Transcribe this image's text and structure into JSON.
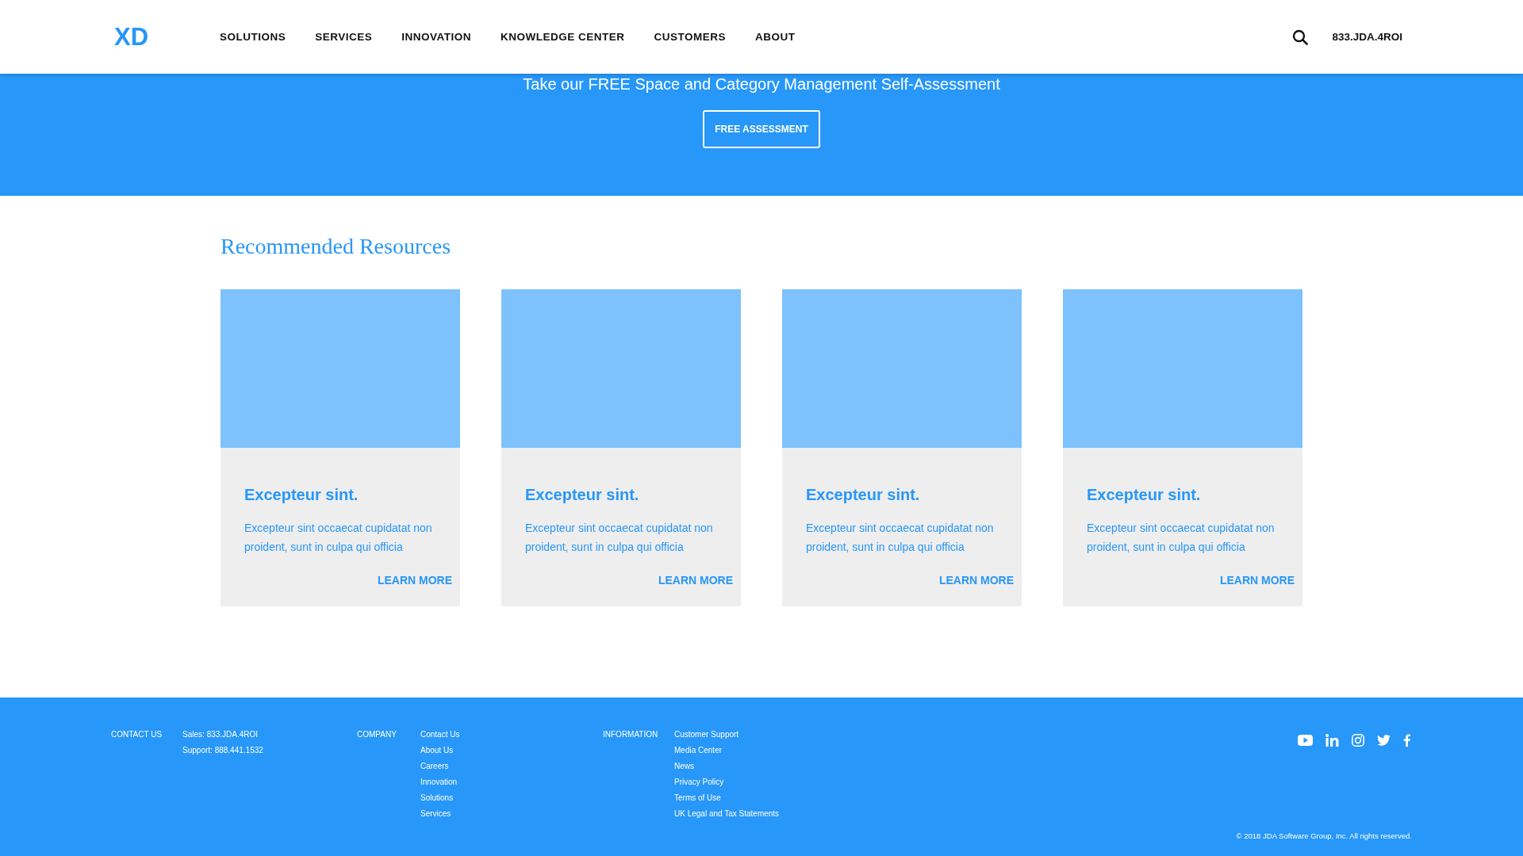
{
  "header": {
    "logo": "XD",
    "nav": [
      "SOLUTIONS",
      "SERVICES",
      "INNOVATION",
      "KNOWLEDGE CENTER",
      "CUSTOMERS",
      "ABOUT"
    ],
    "phone": "833.JDA.4ROI"
  },
  "banner": {
    "text": "Take our FREE Space and Category Management Self-Assessment",
    "button": "FREE ASSESSMENT"
  },
  "resources": {
    "title": "Recommended Resources",
    "cards": [
      {
        "title": "Excepteur sint.",
        "text": "Excepteur sint occaecat cupidatat non proident, sunt in culpa qui officia",
        "link": "LEARN MORE"
      },
      {
        "title": "Excepteur sint.",
        "text": "Excepteur sint occaecat cupidatat non proident, sunt in culpa qui officia",
        "link": "LEARN MORE"
      },
      {
        "title": "Excepteur sint.",
        "text": "Excepteur sint occaecat cupidatat non proident, sunt in culpa qui officia",
        "link": "LEARN MORE"
      },
      {
        "title": "Excepteur sint.",
        "text": "Excepteur sint occaecat cupidatat non proident, sunt in culpa qui officia",
        "link": "LEARN MORE"
      }
    ]
  },
  "footer": {
    "columns": [
      {
        "heading": "CONTACT US",
        "links": [
          "Sales: 833.JDA.4ROI",
          "Support: 888.441.1532"
        ]
      },
      {
        "heading": "COMPANY",
        "links": [
          "Contact Us",
          "About Us",
          "Careers",
          "Innovation",
          "Solutions",
          "Services"
        ]
      },
      {
        "heading": "INFORMATION",
        "links": [
          "Customer Support",
          "Media Center",
          "News",
          "Privacy Policy",
          "Terms of Use",
          "UK Legal and Tax Statements"
        ]
      }
    ],
    "social": [
      {
        "kind": "video"
      },
      {
        "kind": "in"
      },
      {
        "kind": "camera"
      },
      {
        "kind": "bird"
      },
      {
        "kind": "f"
      }
    ],
    "copyright": "© 2018 JDA Software Group, Inc. All rights reserved."
  }
}
